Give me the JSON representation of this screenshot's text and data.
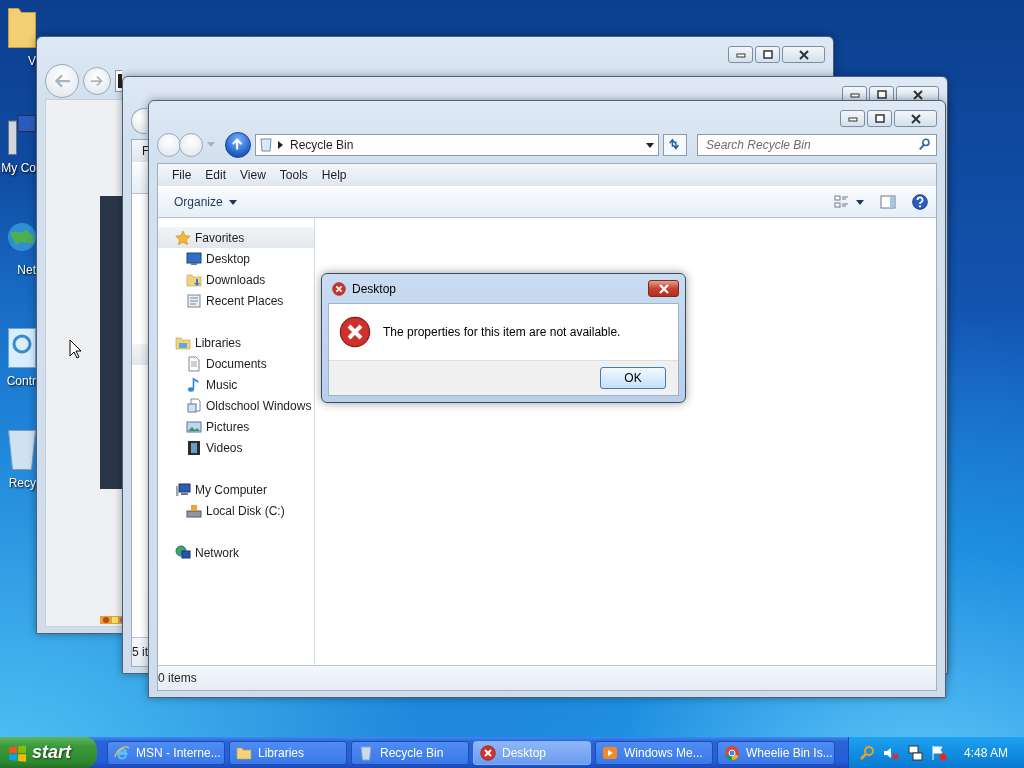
{
  "desktop_icons": [
    {
      "label": "V"
    },
    {
      "label": "My Co"
    },
    {
      "label": "Net"
    },
    {
      "label": "Contr"
    },
    {
      "label": "Recy"
    }
  ],
  "middle_window": {
    "menu_first": "F",
    "status": "5 it"
  },
  "explorer": {
    "address": "Recycle Bin",
    "search": {
      "placeholder": "Search Recycle Bin"
    },
    "menu": [
      "File",
      "Edit",
      "View",
      "Tools",
      "Help"
    ],
    "organize": "Organize",
    "nav": [
      {
        "label": "Favorites",
        "selected": true,
        "children": [
          {
            "label": "Desktop"
          },
          {
            "label": "Downloads"
          },
          {
            "label": "Recent Places"
          }
        ]
      },
      {
        "label": "Libraries",
        "selected": false,
        "children": [
          {
            "label": "Documents"
          },
          {
            "label": "Music"
          },
          {
            "label": "Oldschool Windows"
          },
          {
            "label": "Pictures"
          },
          {
            "label": "Videos"
          }
        ]
      },
      {
        "label": "My Computer",
        "selected": false,
        "children": [
          {
            "label": "Local Disk (C:)"
          }
        ]
      },
      {
        "label": "Network",
        "selected": false
      }
    ],
    "status": "0 items"
  },
  "dialog": {
    "title": "Desktop",
    "message": "The properties for this item are not available.",
    "button": "OK"
  },
  "taskbar": {
    "start": "start",
    "tasks": [
      {
        "label": "MSN - Interne...",
        "selected": false
      },
      {
        "label": "Libraries",
        "selected": false
      },
      {
        "label": "Recycle Bin",
        "selected": false
      },
      {
        "label": "Desktop",
        "selected": true
      },
      {
        "label": "Windows Me...",
        "selected": false
      },
      {
        "label": "Wheelie Bin Is...",
        "selected": false
      }
    ],
    "clock": "4:48 AM"
  }
}
